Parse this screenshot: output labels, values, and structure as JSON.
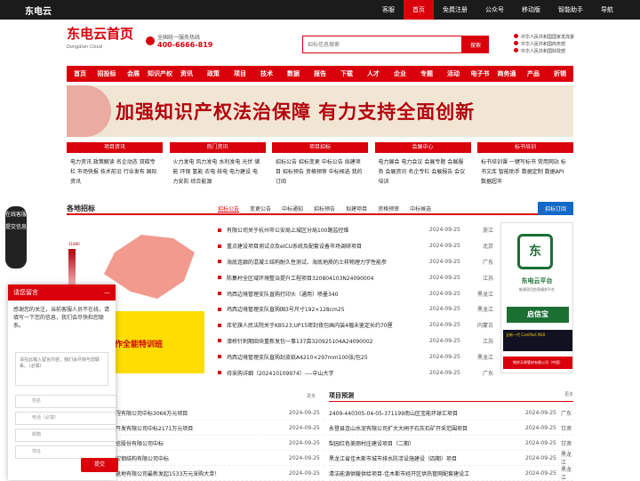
{
  "topbar": {
    "logo": "东电云",
    "links": [
      "客服",
      "首页",
      "免费注册",
      "公众号",
      "移动版",
      "智能助手",
      "导航"
    ]
  },
  "header": {
    "brand": "东电云首页",
    "brand_sub": "Dongdian Cloud",
    "hotline_label": "全国统一服务热线",
    "hotline": "400-6666-819"
  },
  "search": {
    "placeholder": "招标信息搜索",
    "button": "搜索"
  },
  "gov": [
    "中华人民共和国国家发改委",
    "中华人民共和国商务部",
    "中华人民共和国财政部"
  ],
  "nav": [
    "首页",
    "招投标",
    "会展",
    "知识产权",
    "资讯",
    "政策",
    "项目",
    "技术",
    "数据",
    "报告",
    "下载",
    "人才",
    "企业",
    "专题",
    "活动",
    "电子书",
    "商务通",
    "产品",
    "折销"
  ],
  "banner": {
    "text": "加强知识产权法治保障 有力支持全面创新"
  },
  "categories": [
    {
      "title": "项目资讯",
      "items": "电力资讯 政策解读 名企动态 双碳专栏 市场快报 技术前沿 行业发布 国际资讯"
    },
    {
      "title": "热门资讯",
      "items": "火力发电 风力发电 水利发电 光伏 储能 环保 氢能 农电 核电 电力建设 电力安防 综合能源"
    },
    {
      "title": "项目招标",
      "items": "招标公告 招标变更 中标公告 拟建项目 招标预告 资格预审 中标候选 我的订阅"
    },
    {
      "title": "会展中心",
      "items": "电力展会 电力会议 会展专题 会展服务 会展资讯 名企专栏 会展报告 会议培训"
    },
    {
      "title": "标书培训",
      "items": "标书培训课 一键写标书 常用网站 标书文库 智能助手 数据定制 数据API 数据超市"
    }
  ],
  "section": {
    "title": "各地招标",
    "tabs": [
      "招标公告",
      "变更公告",
      "中标通知",
      "招标预告",
      "拟建项目",
      "资格预审",
      "中标候选"
    ],
    "subscribe": "招标订阅"
  },
  "map": {
    "legend_max": "31890"
  },
  "promo": {
    "line1": "知识产权",
    "line2": "专利开放许可",
    "footer": "制作全能特训班"
  },
  "tenders": [
    {
      "title": "有限公司关于杭州市公安局上城区分局100路监控维",
      "date": "2024-09-25",
      "prov": "浙江"
    },
    {
      "title": "重点建设项目测试点及eICU系统及配套设备市场调研项目",
      "date": "2024-09-25",
      "prov": "北京"
    },
    {
      "title": "海底连廊的混凝土结构耐久性测试、海底地质的土样物理力学性能参",
      "date": "2024-09-25",
      "prov": "广东"
    },
    {
      "title": "陈集村全区域环境整治提升工程项目320804103N24090004",
      "date": "2024-09-25",
      "prov": "江苏"
    },
    {
      "title": "鸡西边境管理支队直购打印头（通用）喷墨340",
      "date": "2024-09-25",
      "prov": "黑龙江"
    },
    {
      "title": "鸡西边境管理支队直购国3号尺寸192×128cm25",
      "date": "2024-09-25",
      "prov": "黑龙江"
    },
    {
      "title": "库伦旗人民法院关于KB523;UP15密封夜包画内装4幅未鉴定长约70厘",
      "date": "2024-09-25",
      "prov": "内蒙古"
    },
    {
      "title": "濠桥针刺期田块重新发包一事137亩320925104A24090002",
      "date": "2024-09-25",
      "prov": "江苏"
    },
    {
      "title": "鸡西边境管理支队直购封皮纸A4210×297mm100张/包25",
      "date": "2024-09-25",
      "prov": "黑龙江"
    },
    {
      "title": "待采购详细（202410109974）----中山大学",
      "date": "2024-09-25",
      "prov": "广东"
    }
  ],
  "ad": {
    "qr": "东",
    "name": "东电云平台",
    "slogan": "能源项目信息服务平台",
    "qixin": "启信宝",
    "qixin_url": "Qixin.com",
    "card": "全新一代 ComPact NSX",
    "footer": "铁岭天果管材有限公司（中国）"
  },
  "more": "更多",
  "winbids": [
    {
      "title": "程有限公司中标3066万元项目",
      "date": "2024-09-25"
    },
    {
      "title": "开发有限公司中标2171万元项目",
      "date": "2024-09-25"
    },
    {
      "title": "信股份有限公司中标",
      "date": "2024-09-25"
    },
    {
      "title": "宏钢结构有限公司中标",
      "date": "2024-09-25"
    },
    {
      "title": "退地有限公司最新发起1533万元采购大单！",
      "date": "2024-09-25"
    }
  ],
  "forecast": {
    "title": "项目预测",
    "more": "更多",
    "items": [
      {
        "title": "2409-440305-04-05-371199南山区宝能环球汇项目",
        "date": "2024-09-25",
        "prov": "广东"
      },
      {
        "title": "永登县连山水泥有限公司扩大大闸子石灰石矿开采范围项目",
        "date": "2024-09-25",
        "prov": "甘肃"
      },
      {
        "title": "梨园红色美丽村庄建设项目（二期）",
        "date": "2024-09-25",
        "prov": "甘肃"
      },
      {
        "title": "黑龙江省佳木斯市城市排水防涝设施建设（四期）项目",
        "date": "2024-09-25",
        "prov": "黑龙江"
      },
      {
        "title": "清洁能源供暖供给项目-佳木斯市经开区供热管网配套建设工",
        "date": "2024-09-25",
        "prov": "黑龙江"
      }
    ]
  },
  "side": {
    "a": "在线客服",
    "b": "提交信息"
  },
  "panel": {
    "title": "请您留言",
    "close": "—",
    "msg": "感谢您的关注，当前客服人员不在线，请填写一下您的信息，我们会尽快和您联系。",
    "placeholder": "请在此输入留言内容，我们会尽快与您联系。（必填）",
    "fields": [
      "姓名",
      "电话（必填）",
      "邮箱",
      "地址"
    ],
    "submit": "提交"
  }
}
